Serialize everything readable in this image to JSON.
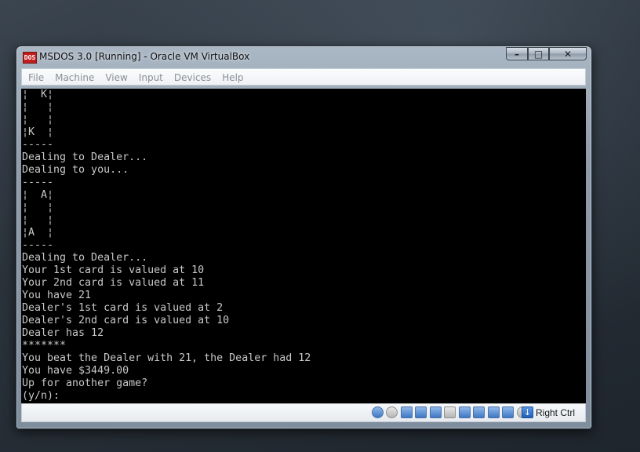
{
  "window": {
    "title": "MSDOS 3.0 [Running] - Oracle VM VirtualBox",
    "app_icon_text": "DOS",
    "controls": {
      "minimize": "–",
      "maximize": "□",
      "close": "✕"
    }
  },
  "menubar": {
    "items": [
      "File",
      "Machine",
      "View",
      "Input",
      "Devices",
      "Help"
    ]
  },
  "terminal": {
    "lines": [
      "¦  K¦",
      "¦   ¦",
      "¦   ¦",
      "¦K  ¦",
      "-----",
      "Dealing to Dealer...",
      "Dealing to you...",
      "-----",
      "¦  A¦",
      "¦   ¦",
      "¦   ¦",
      "¦A  ¦",
      "-----",
      "Dealing to Dealer...",
      "Your 1st card is valued at 10",
      "Your 2nd card is valued at 11",
      "You have 21",
      "Dealer's 1st card is valued at 2",
      "Dealer's 2nd card is valued at 10",
      "Dealer has 12",
      "*******",
      "You beat the Dealer with 21, the Dealer had 12",
      "You have $3449.00",
      "Up for another game?",
      "(y/n):"
    ]
  },
  "statusbar": {
    "icons": [
      "hard-disk-icon",
      "optical-drive-icon",
      "floppy-icon",
      "audio-icon",
      "network-icon",
      "usb-icon",
      "shared-folders-icon",
      "display-icon",
      "video-capture-icon",
      "cpu-virtualization-icon",
      "mouse-integration-icon"
    ],
    "host_key_label": "Right Ctrl"
  },
  "colors": {
    "terminal_bg": "#000000",
    "terminal_fg": "#c8c8c8",
    "menu_disabled_text": "#8a8f96"
  }
}
